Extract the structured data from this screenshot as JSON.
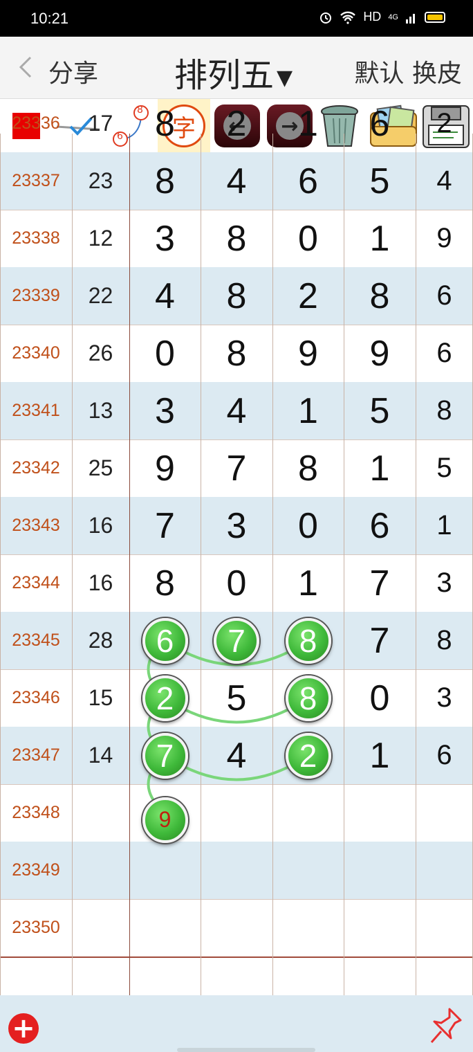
{
  "status_bar": {
    "time": "10:21",
    "network": "HD",
    "signal": "4G"
  },
  "header": {
    "back_label": "分享",
    "title": "排列五",
    "title_caret": "▼",
    "right_label": "默认 换皮"
  },
  "toolbar": {
    "char_label": "字",
    "badge_top": "8",
    "badge_bottom": "6",
    "icons": [
      "red-square-icon",
      "check-line-icon",
      "node-link-icon",
      "char-icon",
      "left-arrow-icon",
      "right-arrow-icon",
      "trash-icon",
      "photo-folder-icon",
      "save-floppy-icon"
    ]
  },
  "rows": [
    {
      "issue": "23336",
      "sum": "17",
      "digits": [
        "8",
        "2",
        "1",
        "6",
        "2"
      ]
    },
    {
      "issue": "23337",
      "sum": "23",
      "digits": [
        "8",
        "4",
        "6",
        "5",
        "4"
      ]
    },
    {
      "issue": "23338",
      "sum": "12",
      "digits": [
        "3",
        "8",
        "0",
        "1",
        "9"
      ]
    },
    {
      "issue": "23339",
      "sum": "22",
      "digits": [
        "4",
        "8",
        "2",
        "8",
        "6"
      ]
    },
    {
      "issue": "23340",
      "sum": "26",
      "digits": [
        "0",
        "8",
        "9",
        "9",
        "6"
      ]
    },
    {
      "issue": "23341",
      "sum": "13",
      "digits": [
        "3",
        "4",
        "1",
        "5",
        "8"
      ]
    },
    {
      "issue": "23342",
      "sum": "25",
      "digits": [
        "9",
        "7",
        "8",
        "1",
        "5"
      ]
    },
    {
      "issue": "23343",
      "sum": "16",
      "digits": [
        "7",
        "3",
        "0",
        "6",
        "1"
      ]
    },
    {
      "issue": "23344",
      "sum": "16",
      "digits": [
        "8",
        "0",
        "1",
        "7",
        "3"
      ]
    },
    {
      "issue": "23345",
      "sum": "28",
      "digits": [
        "6",
        "7",
        "8",
        "7",
        "8"
      ]
    },
    {
      "issue": "23346",
      "sum": "15",
      "digits": [
        "2",
        "5",
        "8",
        "0",
        "3"
      ]
    },
    {
      "issue": "23347",
      "sum": "14",
      "digits": [
        "7",
        "4",
        "2",
        "1",
        "6"
      ]
    },
    {
      "issue": "23348",
      "sum": "",
      "digits": [
        "9",
        "",
        "",
        "",
        ""
      ]
    },
    {
      "issue": "23349",
      "sum": "",
      "digits": [
        "",
        "",
        "",
        "",
        ""
      ]
    },
    {
      "issue": "23350",
      "sum": "",
      "digits": [
        "",
        "",
        "",
        "",
        ""
      ]
    }
  ],
  "highlights": [
    {
      "row": 9,
      "col": 0,
      "value": "6"
    },
    {
      "row": 9,
      "col": 1,
      "value": "7"
    },
    {
      "row": 9,
      "col": 2,
      "value": "8"
    },
    {
      "row": 10,
      "col": 0,
      "value": "2"
    },
    {
      "row": 10,
      "col": 2,
      "value": "8"
    },
    {
      "row": 11,
      "col": 0,
      "value": "7"
    },
    {
      "row": 11,
      "col": 2,
      "value": "2"
    },
    {
      "row": 12,
      "col": 0,
      "value": "9",
      "predicted": true
    }
  ],
  "colors": {
    "issue": "#c0501a",
    "band": "#dceaf2",
    "ball": "#3fb93a",
    "prediction": "#c02010"
  }
}
